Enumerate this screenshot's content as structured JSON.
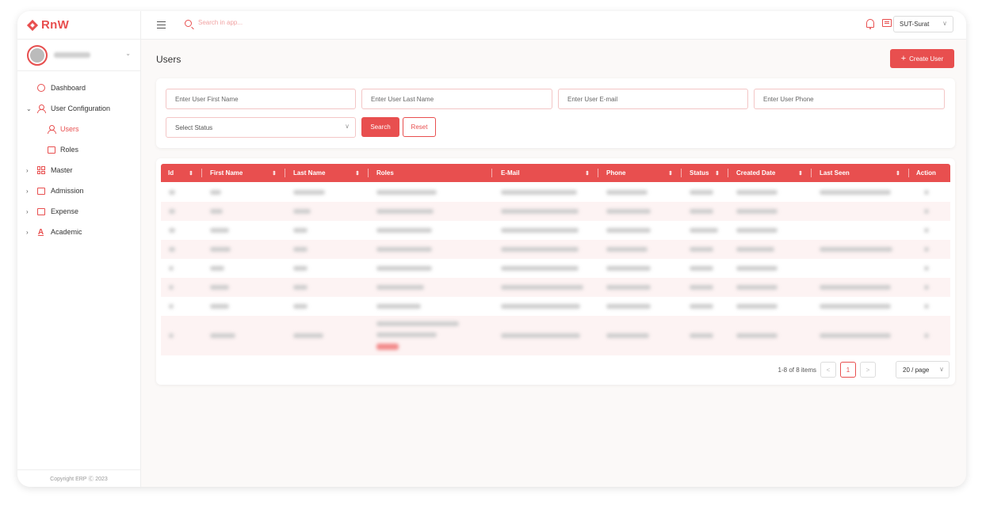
{
  "app": {
    "logo_text": "RnW",
    "copyright": "Copyright ERP Ⓒ 2023"
  },
  "topbar": {
    "search_placeholder": "Search in app...",
    "branch": "SUT-Surat"
  },
  "sidebar": {
    "items": [
      {
        "label": "Dashboard",
        "icon": "dashboard-icon"
      },
      {
        "label": "User Configuration",
        "icon": "user-icon",
        "expanded": true
      },
      {
        "label": "Users",
        "icon": "users-icon",
        "active": true
      },
      {
        "label": "Roles",
        "icon": "roles-icon"
      },
      {
        "label": "Master",
        "icon": "grid-icon"
      },
      {
        "label": "Admission",
        "icon": "admission-icon"
      },
      {
        "label": "Expense",
        "icon": "expense-icon"
      },
      {
        "label": "Academic",
        "icon": "academic-icon"
      }
    ]
  },
  "page": {
    "title": "Users",
    "create_label": "Create User"
  },
  "filters": {
    "first_name_placeholder": "Enter User First Name",
    "last_name_placeholder": "Enter User Last Name",
    "email_placeholder": "Enter User E-mail",
    "phone_placeholder": "Enter User Phone",
    "status_placeholder": "Select Status",
    "search_label": "Search",
    "reset_label": "Reset"
  },
  "table": {
    "columns": [
      "Id",
      "First Name",
      "Last Name",
      "Roles",
      "E-Mail",
      "Phone",
      "Status",
      "Created Date",
      "Last Seen",
      "Action"
    ]
  },
  "pagination": {
    "summary": "1-8 of 8 items",
    "current_page": "1",
    "page_size": "20 / page"
  },
  "colors": {
    "accent": "#e84f4f"
  }
}
